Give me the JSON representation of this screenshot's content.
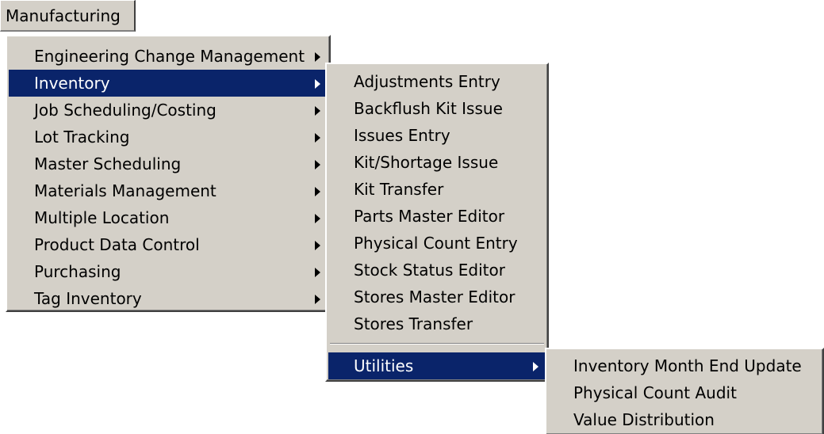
{
  "menubar": {
    "label": "Manufacturing"
  },
  "main_menu": {
    "items": [
      {
        "label": "Engineering Change Management"
      },
      {
        "label": "Inventory"
      },
      {
        "label": "Job Scheduling/Costing"
      },
      {
        "label": "Lot Tracking"
      },
      {
        "label": "Master Scheduling"
      },
      {
        "label": "Materials Management"
      },
      {
        "label": "Multiple Location"
      },
      {
        "label": "Product Data Control"
      },
      {
        "label": "Purchasing"
      },
      {
        "label": "Tag Inventory"
      }
    ],
    "selected": "Inventory"
  },
  "inventory_menu": {
    "items": [
      {
        "label": "Adjustments Entry"
      },
      {
        "label": "Backflush Kit Issue"
      },
      {
        "label": "Issues Entry"
      },
      {
        "label": "Kit/Shortage Issue"
      },
      {
        "label": "Kit Transfer"
      },
      {
        "label": "Parts Master Editor"
      },
      {
        "label": "Physical Count Entry"
      },
      {
        "label": "Stock Status Editor"
      },
      {
        "label": "Stores Master Editor"
      },
      {
        "label": "Stores Transfer"
      }
    ],
    "utilities_label": "Utilities",
    "selected": "Utilities"
  },
  "utilities_menu": {
    "items": [
      {
        "label": "Inventory Month End Update"
      },
      {
        "label": "Physical Count Audit"
      },
      {
        "label": "Value Distribution"
      }
    ]
  },
  "colors": {
    "menu_bg": "#d4d0c8",
    "highlight": "#0a246a",
    "highlight_text": "#ffffff"
  }
}
